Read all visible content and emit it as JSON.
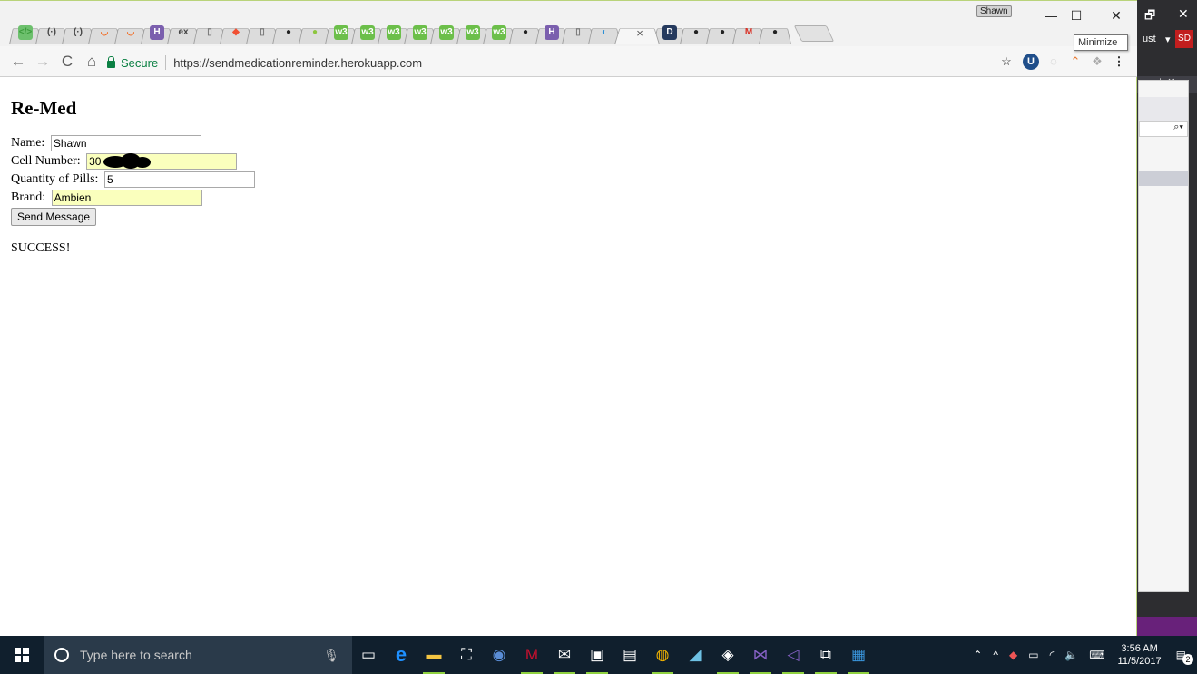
{
  "browser": {
    "profile_name": "Shawn",
    "tooltip": "Minimize",
    "url_secure": "Secure",
    "url": "https://sendmedicationreminder.herokuapp.com",
    "tab_favicons": [
      {
        "icon": "</>",
        "color": "#3c9b3c",
        "bg": "#6dc06d"
      },
      {
        "icon": "(·)",
        "color": "#444",
        "bg": "transparent"
      },
      {
        "icon": "(·)",
        "color": "#444",
        "bg": "transparent"
      },
      {
        "icon": "◡",
        "color": "#f26a21",
        "bg": "transparent"
      },
      {
        "icon": "◡",
        "color": "#f26a21",
        "bg": "transparent"
      },
      {
        "icon": "H",
        "color": "#fff",
        "bg": "#7b5fae"
      },
      {
        "icon": "ex",
        "color": "#444",
        "bg": "transparent"
      },
      {
        "icon": "▯",
        "color": "#777",
        "bg": "transparent"
      },
      {
        "icon": "◆",
        "color": "#f05033",
        "bg": "transparent"
      },
      {
        "icon": "▯",
        "color": "#777",
        "bg": "transparent"
      },
      {
        "icon": "●",
        "color": "#222",
        "bg": "transparent"
      },
      {
        "icon": "●",
        "color": "#8dc63f",
        "bg": "transparent"
      },
      {
        "icon": "w3",
        "color": "#fff",
        "bg": "#6cbf4a"
      },
      {
        "icon": "w3",
        "color": "#fff",
        "bg": "#6cbf4a"
      },
      {
        "icon": "w3",
        "color": "#fff",
        "bg": "#6cbf4a"
      },
      {
        "icon": "w3",
        "color": "#fff",
        "bg": "#6cbf4a"
      },
      {
        "icon": "w3",
        "color": "#fff",
        "bg": "#6cbf4a"
      },
      {
        "icon": "w3",
        "color": "#fff",
        "bg": "#6cbf4a"
      },
      {
        "icon": "w3",
        "color": "#fff",
        "bg": "#6cbf4a"
      },
      {
        "icon": "●",
        "color": "#222",
        "bg": "transparent"
      },
      {
        "icon": "H",
        "color": "#fff",
        "bg": "#7b5fae"
      },
      {
        "icon": "▯",
        "color": "#777",
        "bg": "transparent"
      },
      {
        "icon": "◐",
        "color": "#2b8fd6",
        "bg": "transparent"
      }
    ],
    "active_tab_close": "×",
    "tab_favicons_after": [
      {
        "icon": "D",
        "color": "#fff",
        "bg": "#253a5e"
      },
      {
        "icon": "●",
        "color": "#222",
        "bg": "transparent"
      },
      {
        "icon": "●",
        "color": "#222",
        "bg": "transparent"
      },
      {
        "icon": "M",
        "color": "#d93025",
        "bg": "transparent"
      },
      {
        "icon": "●",
        "color": "#222",
        "bg": "transparent"
      }
    ]
  },
  "page": {
    "title": "Re-Med",
    "name_label": "Name: ",
    "name_value": "Shawn",
    "cell_label": "Cell Number: ",
    "cell_value": "30          7",
    "qty_label": "Quantity of Pills: ",
    "qty_value": "5",
    "brand_label": "Brand: ",
    "brand_value": "Ambien",
    "send_button": "Send Message",
    "result": "SUCCESS!"
  },
  "side_window": {
    "menu_text": "ust",
    "avatar": "SD"
  },
  "taskbar": {
    "search_placeholder": "Type here to search",
    "time": "3:56 AM",
    "date": "11/5/2017",
    "notification_count": "2"
  }
}
